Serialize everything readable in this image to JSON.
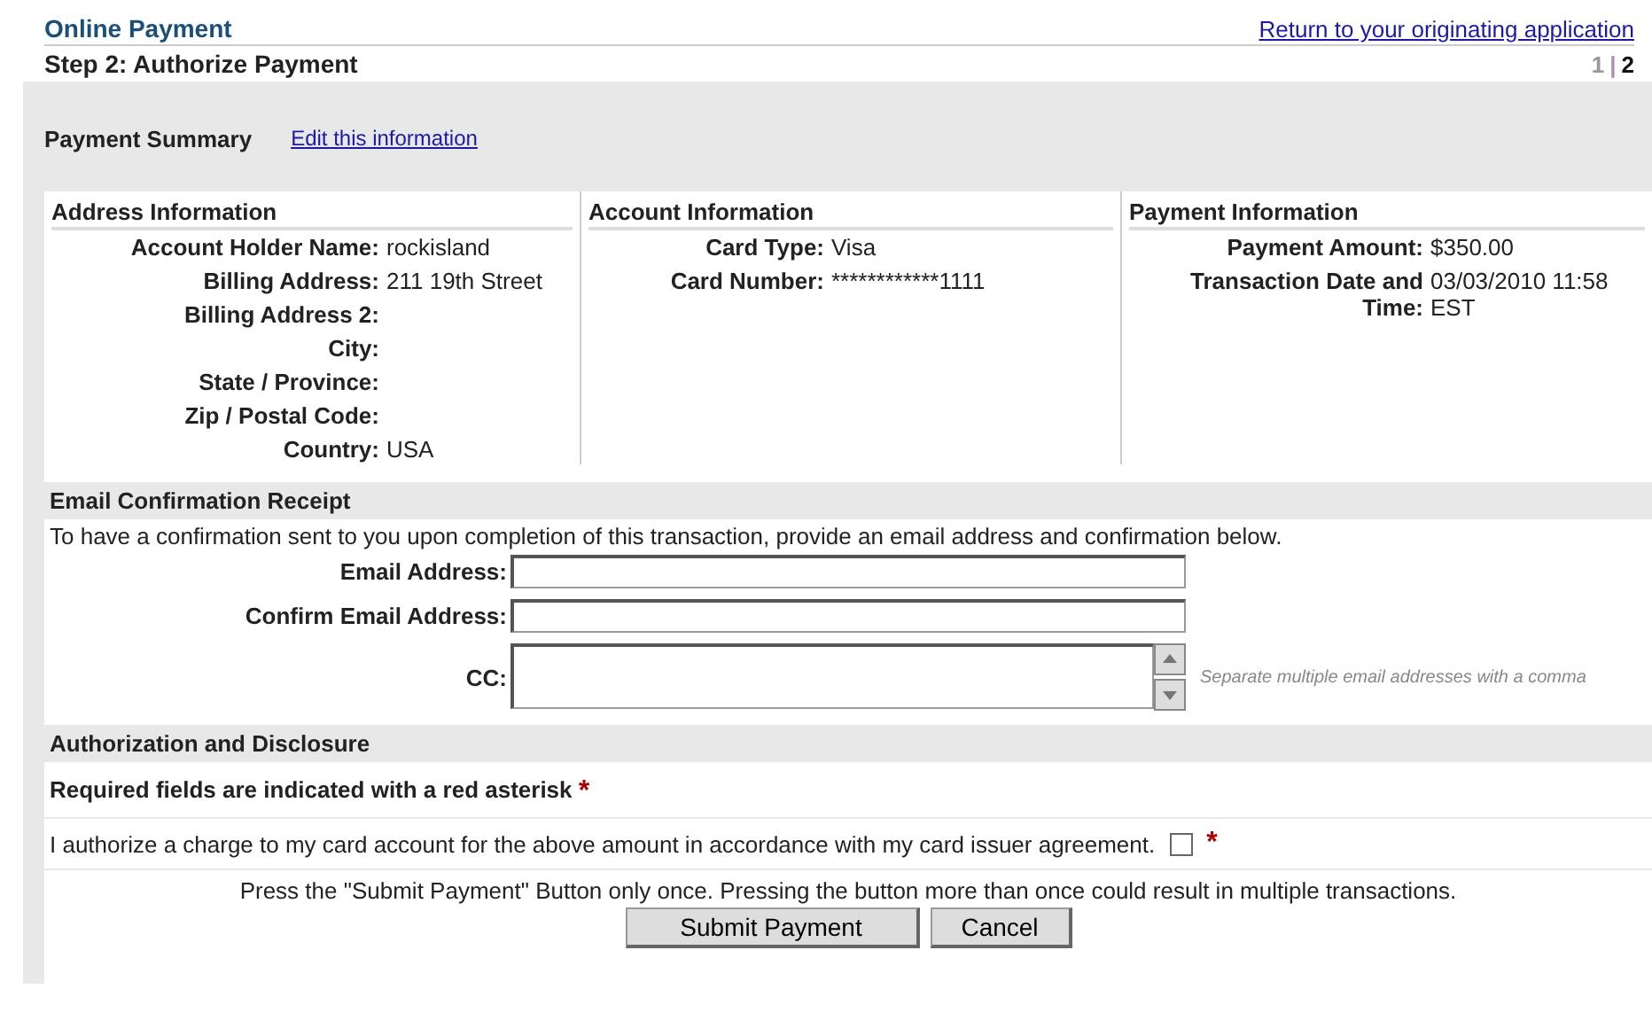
{
  "header": {
    "title": "Online Payment",
    "return_link": "Return to your originating application",
    "step_title": "Step 2: Authorize Payment",
    "steps": [
      {
        "label": "1",
        "selected": false
      },
      {
        "label": "2",
        "selected": true
      }
    ],
    "step_separator": "|"
  },
  "summary": {
    "title": "Payment Summary",
    "edit_link": "Edit this information"
  },
  "columns": [
    {
      "title": "Address Information",
      "rows": [
        {
          "label": "Account Holder Name:",
          "value": "rockisland"
        },
        {
          "label": "Billing Address:",
          "value": "211 19th Street"
        },
        {
          "label": "Billing Address 2:",
          "value": ""
        },
        {
          "label": "City:",
          "value": ""
        },
        {
          "label": "State / Province:",
          "value": ""
        },
        {
          "label": "Zip / Postal Code:",
          "value": ""
        },
        {
          "label": "Country:",
          "value": "USA"
        }
      ]
    },
    {
      "title": "Account Information",
      "rows": [
        {
          "label": "Card Type:",
          "value": "Visa"
        },
        {
          "label": "Card Number:",
          "value": "************1111"
        }
      ]
    },
    {
      "title": "Payment Information",
      "rows": [
        {
          "label": "Payment Amount:",
          "value": "$350.00"
        },
        {
          "label": "Transaction Date and Time:",
          "value": "03/03/2010 11:58 EST"
        }
      ]
    }
  ],
  "email": {
    "title": "Email Confirmation Receipt",
    "instructions": "To have a confirmation sent to you upon completion of this transaction, provide an email address and confirmation below.",
    "fields": [
      {
        "kind": "input",
        "label": "Email Address:"
      },
      {
        "kind": "input",
        "label": "Confirm Email Address:"
      },
      {
        "kind": "textarea",
        "label": "CC:",
        "hint": "Separate multiple email addresses with a comma"
      }
    ]
  },
  "authorization": {
    "title": "Authorization and Disclosure",
    "required_note": "Required fields are indicated with a red asterisk",
    "required_mark": "*",
    "agreement": "I authorize a charge to my card account for the above amount in accordance with my card issuer agreement.",
    "agreement_checked": false,
    "agreement_mark": "*",
    "notice": "Press the \"Submit Payment\" Button only once. Pressing the button more than once could result in multiple transactions.",
    "buttons": [
      "Submit Payment",
      "Cancel"
    ]
  }
}
